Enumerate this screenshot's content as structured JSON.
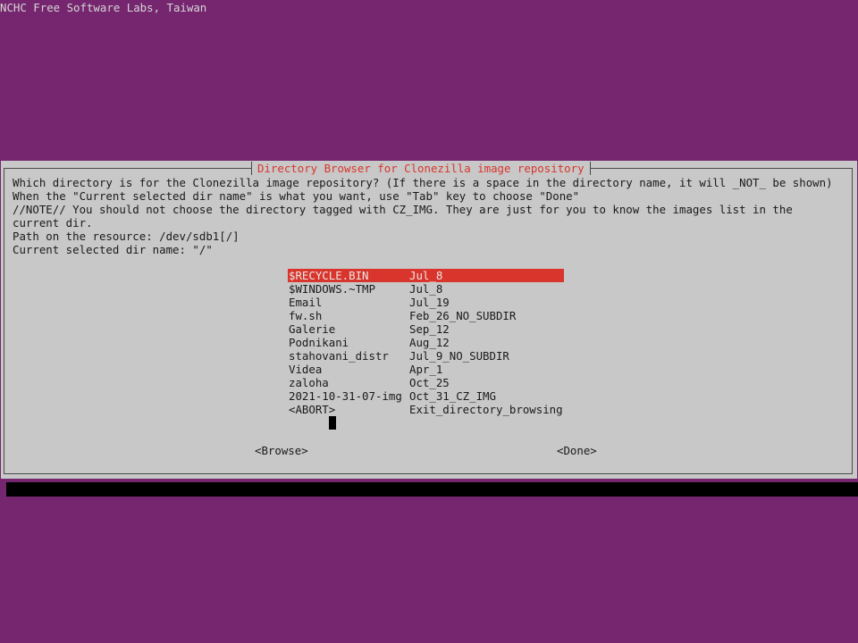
{
  "backtitle": "NCHC Free Software Labs, Taiwan",
  "dialog": {
    "title": "Directory Browser for Clonezilla image repository",
    "prompt_lines": [
      "Which directory is for the Clonezilla image repository? (If there is a space in the directory name, it will _NOT_ be shown)",
      "When the \"Current selected dir name\" is what you want, use \"Tab\" key to choose \"Done\"",
      "//NOTE// You should not choose the directory tagged with CZ_IMG. They are just for you to know the images list in the",
      "current dir.",
      "Path on the resource: /dev/sdb1[/]",
      "Current selected dir name: \"/\""
    ],
    "menu": [
      {
        "tag": "$RECYCLE.BIN",
        "item": "Jul_8",
        "selected": true
      },
      {
        "tag": "$WINDOWS.~TMP",
        "item": "Jul_8"
      },
      {
        "tag": "Email",
        "item": "Jul_19"
      },
      {
        "tag": "fw.sh",
        "item": "Feb_26_NO_SUBDIR"
      },
      {
        "tag": "Galerie",
        "item": "Sep_12"
      },
      {
        "tag": "Podnikani",
        "item": "Aug_12"
      },
      {
        "tag": "stahovani_distr",
        "item": "Jul_9_NO_SUBDIR"
      },
      {
        "tag": "Videa",
        "item": "Apr_1"
      },
      {
        "tag": "zaloha",
        "item": "Oct_25"
      },
      {
        "tag": "2021-10-31-07-img",
        "item": "Oct_31_CZ_IMG"
      },
      {
        "tag": "<ABORT>",
        "item": "Exit_directory_browsing"
      }
    ],
    "buttons": {
      "browse": "<Browse>",
      "done": "<Done>"
    }
  },
  "colors": {
    "desktop": "#75266f",
    "dialog_bg": "#c8c8c8",
    "accent_red": "#d9352c",
    "text": "#1a1a1a"
  }
}
